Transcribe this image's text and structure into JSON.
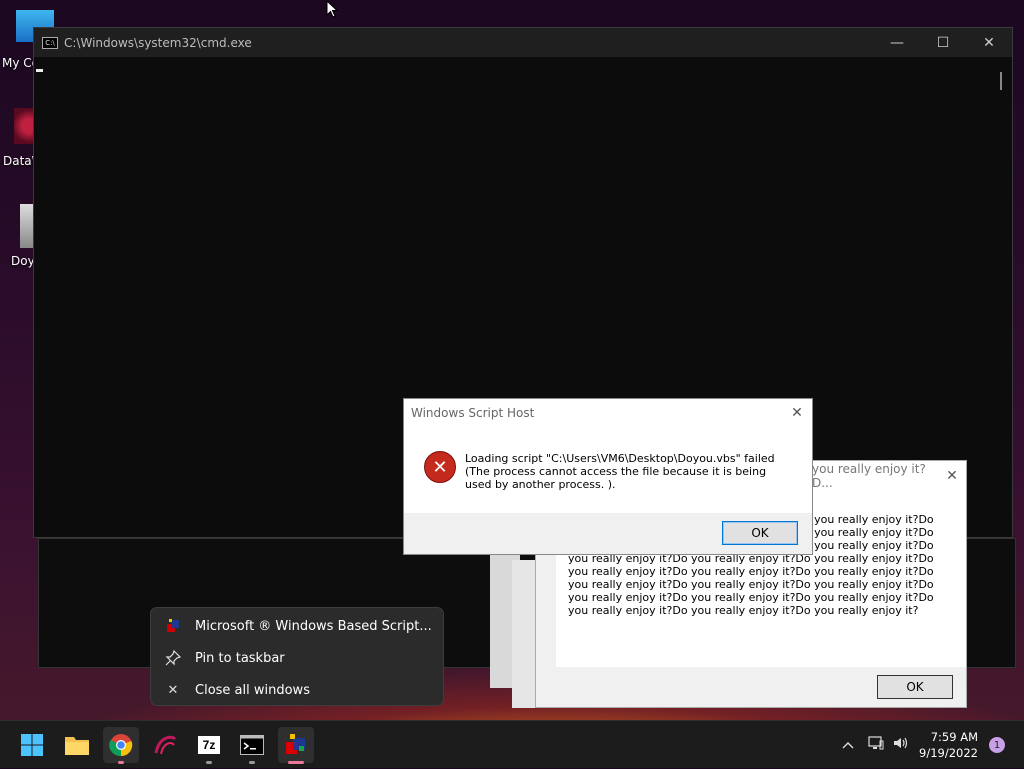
{
  "desktop": {
    "icons": [
      {
        "label": "My Co",
        "icon": "monitor-icon"
      },
      {
        "label": "DataW",
        "icon": "datawave-icon"
      },
      {
        "label": "Doy",
        "icon": "script-file-icon"
      }
    ]
  },
  "cmd_window": {
    "title": "C:\\Windows\\system32\\cmd.exe",
    "icon_text": "C:\\",
    "minimize": "—",
    "maximize": "☐",
    "close": "✕"
  },
  "loop_window": {
    "title": "you really enjoy it?D...",
    "close": "✕",
    "text": "you really enjoy it?Do you really enjoy it?Do you really enjoy it?Do you really enjoy it?Do you really enjoy it?Do you really enjoy it?Do you really enjoy it?Do you really enjoy it?Do you really enjoy it?Do you really enjoy it?Do you really enjoy it?Do you really enjoy it?Do you really enjoy it?Do you really enjoy it?Do you really enjoy it?Do you really enjoy it?Do you really enjoy it?Do you really enjoy it?Do you really enjoy it?Do you really enjoy it?Do you really enjoy it?Do you really enjoy it?Do you really enjoy it?Do you really enjoy it?",
    "ok_label": "OK"
  },
  "error_dialog": {
    "title": "Windows Script Host",
    "close": "✕",
    "message": "Loading script \"C:\\Users\\VM6\\Desktop\\Doyou.vbs\" failed (The process cannot access the file because it is being used by another process. ).",
    "ok_label": "OK",
    "icon": "error-icon",
    "accent": "#c42b1c"
  },
  "jump_list": {
    "items": [
      {
        "label": "Microsoft ® Windows Based Script...",
        "icon": "script-host-icon"
      },
      {
        "label": "Pin to taskbar",
        "icon": "pin-icon"
      },
      {
        "label": "Close all windows",
        "icon": "close-icon"
      }
    ]
  },
  "taskbar": {
    "apps": [
      "start-icon",
      "file-explorer-icon",
      "chrome-icon",
      "datawave-icon",
      "7zip-icon",
      "cmd-icon",
      "script-host-icon"
    ],
    "sevenzip_label": "7z",
    "clock_time": "7:59 AM",
    "clock_date": "9/19/2022",
    "notification_count": "1",
    "accent": "#e8779a"
  }
}
